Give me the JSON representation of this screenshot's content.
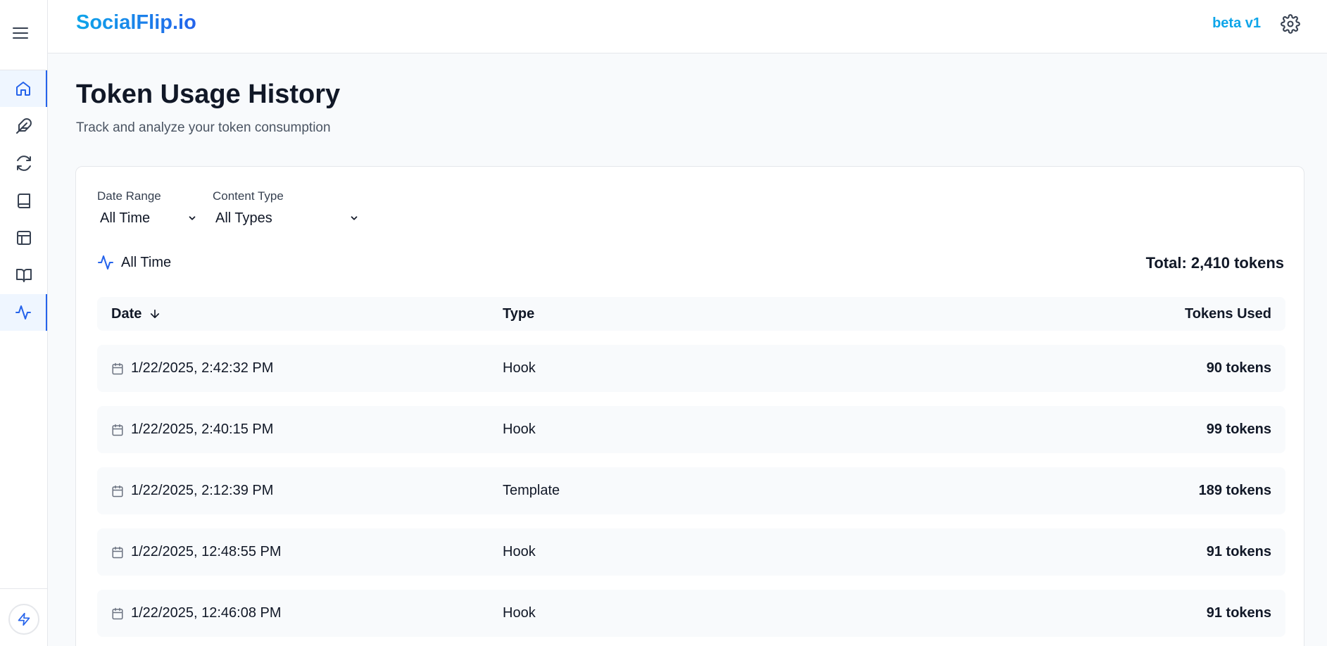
{
  "app": {
    "brand": "SocialFlip.io",
    "version_badge": "beta v1"
  },
  "sidebar": {
    "items": [
      {
        "name": "home",
        "icon": "home-icon",
        "active": true
      },
      {
        "name": "feather",
        "icon": "feather-icon",
        "active": false
      },
      {
        "name": "refresh",
        "icon": "refresh-icon",
        "active": false
      },
      {
        "name": "book",
        "icon": "book-icon",
        "active": false
      },
      {
        "name": "layout",
        "icon": "layout-icon",
        "active": false
      },
      {
        "name": "book-open",
        "icon": "book-open-icon",
        "active": false
      },
      {
        "name": "activity",
        "icon": "activity-icon",
        "active": true
      }
    ]
  },
  "page": {
    "title": "Token Usage History",
    "subtitle": "Track and analyze your token consumption"
  },
  "filters": {
    "date_range": {
      "label": "Date Range",
      "value": "All Time"
    },
    "content_type": {
      "label": "Content Type",
      "value": "All Types"
    }
  },
  "summary": {
    "range_label": "All Time",
    "total": "Total: 2,410 tokens"
  },
  "table": {
    "headers": {
      "date": "Date",
      "type": "Type",
      "tokens": "Tokens Used"
    },
    "rows": [
      {
        "date": "1/22/2025, 2:42:32 PM",
        "type": "Hook",
        "tokens": "90 tokens"
      },
      {
        "date": "1/22/2025, 2:40:15 PM",
        "type": "Hook",
        "tokens": "99 tokens"
      },
      {
        "date": "1/22/2025, 2:12:39 PM",
        "type": "Template",
        "tokens": "189 tokens"
      },
      {
        "date": "1/22/2025, 12:48:55 PM",
        "type": "Hook",
        "tokens": "91 tokens"
      },
      {
        "date": "1/22/2025, 12:46:08 PM",
        "type": "Hook",
        "tokens": "91 tokens"
      }
    ]
  },
  "colors": {
    "accent": "#2563eb",
    "brand_start": "#0ea5e9",
    "brand_end": "#2563eb"
  }
}
